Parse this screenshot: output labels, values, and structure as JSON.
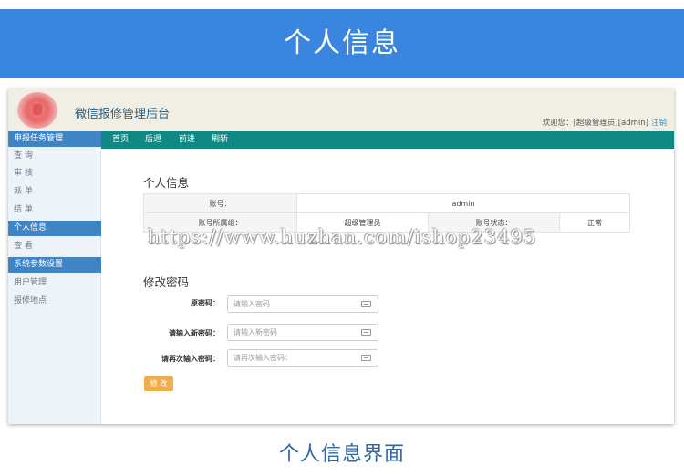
{
  "banner": {
    "title": "个人信息"
  },
  "header": {
    "app_title": "微信报修管理后台",
    "user_prefix": "欢迎您：",
    "user_role": "[超级管理员][admin]",
    "logout": "注销"
  },
  "sidebar": {
    "items": [
      {
        "label": "申报任务管理",
        "type": "group"
      },
      {
        "label": "查 询",
        "type": "link"
      },
      {
        "label": "审 核",
        "type": "link"
      },
      {
        "label": "派 单",
        "type": "link"
      },
      {
        "label": "结 单",
        "type": "link"
      },
      {
        "label": "个人信息",
        "type": "active"
      },
      {
        "label": "查 看",
        "type": "link"
      },
      {
        "label": "系统参数设置",
        "type": "group"
      },
      {
        "label": "用户管理",
        "type": "link"
      },
      {
        "label": "报修地点",
        "type": "link"
      }
    ]
  },
  "nav": {
    "home": "首页",
    "back": "后退",
    "forward": "前进",
    "refresh": "刷新"
  },
  "profile": {
    "title": "个人信息",
    "account_label": "账号：",
    "account_value": "admin",
    "group_label": "账号所属组：",
    "group_value": "超级管理员",
    "status_label": "账号状态：",
    "status_value": "正常"
  },
  "password": {
    "title": "修改密码",
    "old_label": "原密码：",
    "old_placeholder": "请输入密码",
    "new_label": "请输入新密码：",
    "new_placeholder": "请输入新密码",
    "confirm_label": "请再次输入密码：",
    "confirm_placeholder": "请再次输入密码：",
    "submit": "修 改"
  },
  "watermark": "https://www.huzhan.com/ishop23495",
  "caption": "个人信息界面",
  "colors": {
    "banner": "#3a85df",
    "sidebar_active": "#3f85c6",
    "navbar": "#108985",
    "submit": "#f0ad4e",
    "caption": "#2f66a6"
  }
}
